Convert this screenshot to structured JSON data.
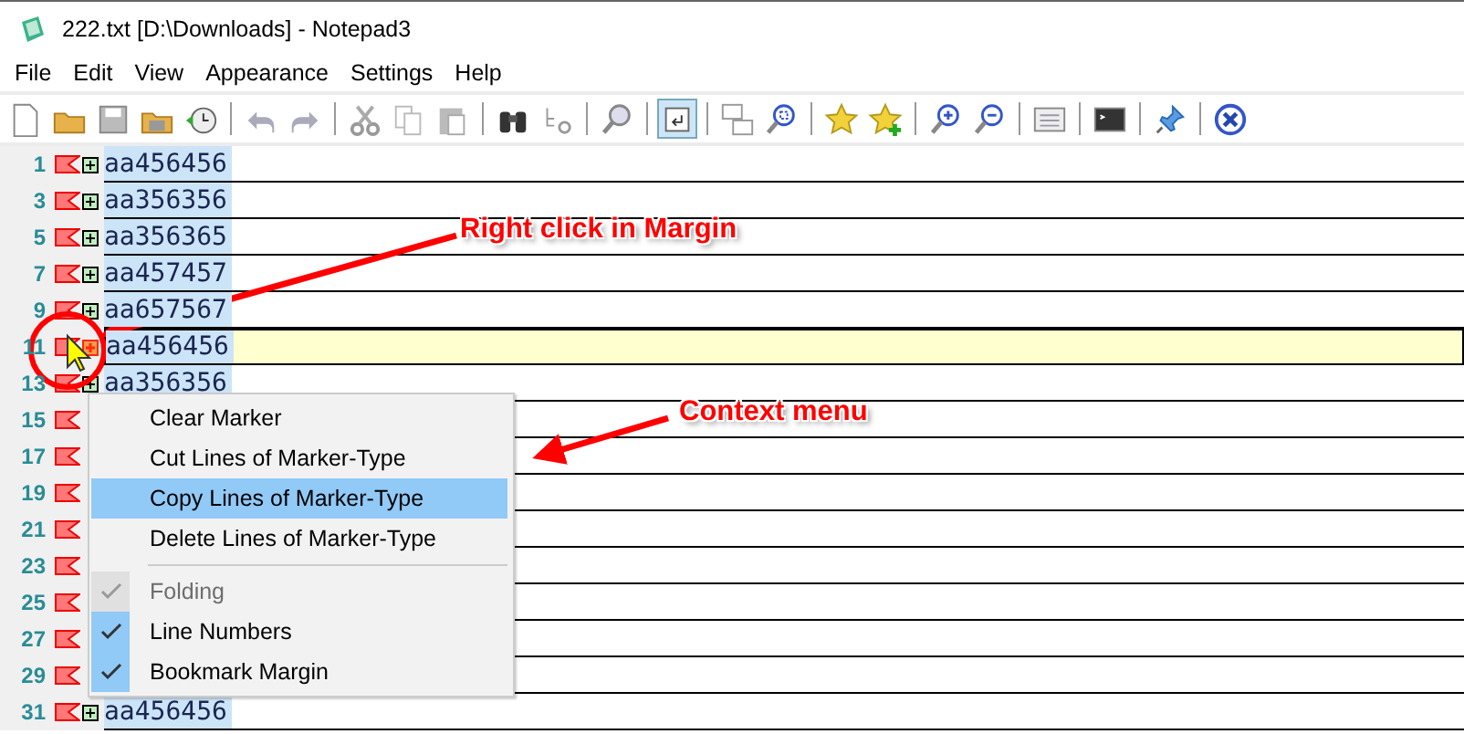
{
  "window": {
    "title": "222.txt [D:\\Downloads] - Notepad3"
  },
  "menubar": [
    "File",
    "Edit",
    "View",
    "Appearance",
    "Settings",
    "Help"
  ],
  "toolbar": [
    [
      {
        "pressed": false
      },
      {
        "pressed": false
      },
      {
        "pressed": false
      },
      {
        "pressed": false
      },
      {
        "pressed": false
      }
    ],
    [
      {
        "pressed": false
      },
      {
        "pressed": false
      }
    ],
    [
      {
        "pressed": false
      },
      {
        "pressed": false
      },
      {
        "pressed": false
      }
    ],
    [
      {
        "pressed": false
      },
      {
        "pressed": false
      }
    ],
    [
      {
        "pressed": false
      }
    ],
    [
      {
        "pressed": true
      }
    ],
    [
      {
        "pressed": false
      },
      {
        "pressed": false
      }
    ],
    [
      {
        "pressed": false
      },
      {
        "pressed": false
      }
    ],
    [
      {
        "pressed": false
      },
      {
        "pressed": false
      }
    ],
    [
      {
        "pressed": false
      }
    ],
    [
      {
        "pressed": false
      }
    ],
    [
      {
        "pressed": false
      }
    ],
    [
      {
        "pressed": false
      }
    ]
  ],
  "lines": [
    {
      "number": "1",
      "bookmark": true,
      "fold_box": true,
      "hovered": false,
      "current": false,
      "text": "aa456456"
    },
    {
      "number": "3",
      "bookmark": true,
      "fold_box": true,
      "hovered": false,
      "current": false,
      "text": "aa356356"
    },
    {
      "number": "5",
      "bookmark": true,
      "fold_box": true,
      "hovered": false,
      "current": false,
      "text": "aa356365"
    },
    {
      "number": "7",
      "bookmark": true,
      "fold_box": true,
      "hovered": false,
      "current": false,
      "text": "aa457457"
    },
    {
      "number": "9",
      "bookmark": true,
      "fold_box": true,
      "hovered": false,
      "current": false,
      "text": "aa657567"
    },
    {
      "number": "11",
      "bookmark": true,
      "fold_box": true,
      "hovered": true,
      "current": true,
      "text": "aa456456"
    },
    {
      "number": "13",
      "bookmark": true,
      "fold_box": true,
      "hovered": false,
      "current": false,
      "text": "aa356356"
    },
    {
      "number": "15",
      "bookmark": true,
      "fold_box": false,
      "current": false
    },
    {
      "number": "17",
      "bookmark": true,
      "fold_box": false,
      "current": false
    },
    {
      "number": "19",
      "bookmark": true,
      "fold_box": false,
      "current": false
    },
    {
      "number": "21",
      "bookmark": true,
      "fold_box": false,
      "current": false
    },
    {
      "number": "23",
      "bookmark": true,
      "fold_box": false,
      "current": false
    },
    {
      "number": "25",
      "bookmark": true,
      "fold_box": false,
      "current": false
    },
    {
      "number": "27",
      "bookmark": true,
      "fold_box": false,
      "current": false
    },
    {
      "number": "29",
      "bookmark": true,
      "fold_box": false,
      "current": false
    },
    {
      "number": "31",
      "bookmark": true,
      "fold_box": true,
      "hovered": false,
      "current": false,
      "text": "aa456456"
    }
  ],
  "context_menu": [
    {
      "kind": "command",
      "label": "Clear Marker",
      "selected": false
    },
    {
      "kind": "command",
      "label": "Cut Lines of Marker-Type",
      "selected": false
    },
    {
      "kind": "command",
      "label": "Copy Lines of Marker-Type",
      "selected": true
    },
    {
      "kind": "command",
      "label": "Delete Lines of Marker-Type",
      "selected": false
    },
    {
      "kind": "separator"
    },
    {
      "kind": "toggle",
      "label": "Folding",
      "checked": true,
      "disabled": true
    },
    {
      "kind": "toggle",
      "label": "Line Numbers",
      "checked": true,
      "disabled": false
    },
    {
      "kind": "toggle",
      "label": "Bookmark Margin",
      "checked": true,
      "disabled": false
    }
  ],
  "annotations": [
    {
      "text": "Right click in Margin"
    },
    {
      "text": "Context menu"
    }
  ]
}
